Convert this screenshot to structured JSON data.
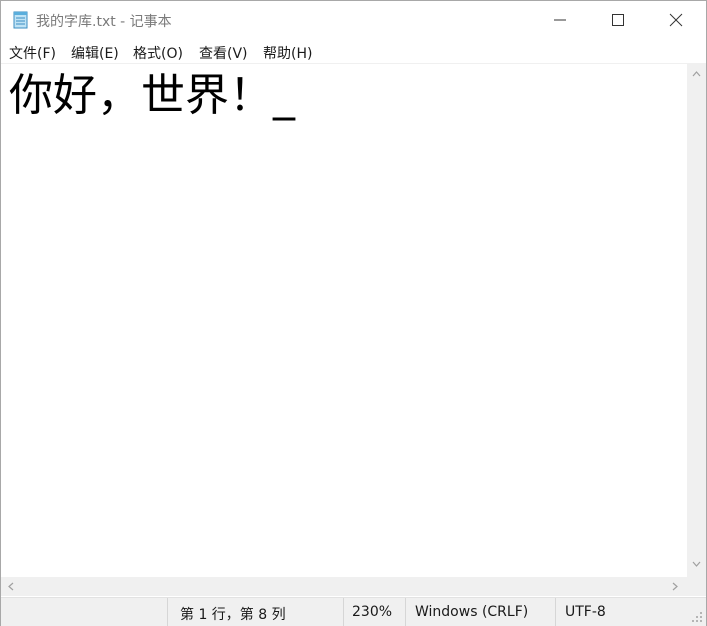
{
  "window": {
    "title": "我的字库.txt - 记事本"
  },
  "menu": [
    {
      "label": "文件(F)"
    },
    {
      "label": "编辑(E)"
    },
    {
      "label": "格式(O)"
    },
    {
      "label": "查看(V)"
    },
    {
      "label": "帮助(H)"
    }
  ],
  "editor": {
    "content": "你好，世界！_"
  },
  "status": {
    "position": "第 1 行，第 8 列",
    "zoom": "230%",
    "line_ending": "Windows (CRLF)",
    "encoding": "UTF-8"
  },
  "icons": {
    "app": "notepad-icon",
    "minimize": "minimize-icon",
    "maximize": "maximize-icon",
    "close": "close-icon"
  },
  "colors": {
    "title_text": "#7a7a7a",
    "chrome": "#f0f0f0",
    "text": "#000000"
  }
}
